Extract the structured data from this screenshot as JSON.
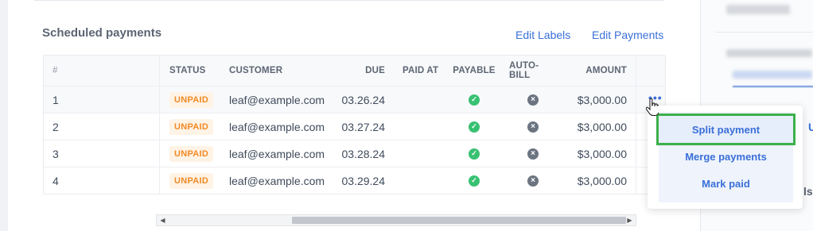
{
  "section": {
    "title": "Scheduled payments",
    "edit_labels": "Edit Labels",
    "edit_payments": "Edit Payments"
  },
  "table": {
    "headers": {
      "num": "#",
      "status": "STATUS",
      "customer": "CUSTOMER",
      "due": "DUE",
      "paid_at": "PAID AT",
      "payable": "PAYABLE",
      "auto_bill": "AUTO-BILL",
      "amount": "AMOUNT"
    },
    "rows": [
      {
        "num": "1",
        "status": "UNPAID",
        "customer": "leaf@example.com",
        "due": "03.26.24",
        "paid_at": "",
        "payable": "check-icon",
        "auto_bill": "x-icon",
        "amount": "$3,000.00"
      },
      {
        "num": "2",
        "status": "UNPAID",
        "customer": "leaf@example.com",
        "due": "03.27.24",
        "paid_at": "",
        "payable": "check-icon",
        "auto_bill": "x-icon",
        "amount": "$3,000.00"
      },
      {
        "num": "3",
        "status": "UNPAID",
        "customer": "leaf@example.com",
        "due": "03.28.24",
        "paid_at": "",
        "payable": "check-icon",
        "auto_bill": "x-icon",
        "amount": "$3,000.00"
      },
      {
        "num": "4",
        "status": "UNPAID",
        "customer": "leaf@example.com",
        "due": "03.29.24",
        "paid_at": "",
        "payable": "check-icon",
        "auto_bill": "x-icon",
        "amount": "$3,000.00"
      }
    ],
    "row_menu_glyph": "•••"
  },
  "dropdown": {
    "items": [
      "Split payment",
      "Merge payments",
      "Mark paid"
    ],
    "selected_index": 0
  },
  "scrollbar": {
    "left_arrow": "◀",
    "right_arrow": "▶"
  },
  "right_panel": {
    "fragment_u": "U",
    "fragment_ls": "ls"
  },
  "colors": {
    "accent": "#3a6fd8",
    "badge_text": "#f08a24",
    "badge_bg": "#fff3e6",
    "check": "#38c172",
    "x": "#6b7480",
    "highlight_outline": "#3cb04a"
  }
}
